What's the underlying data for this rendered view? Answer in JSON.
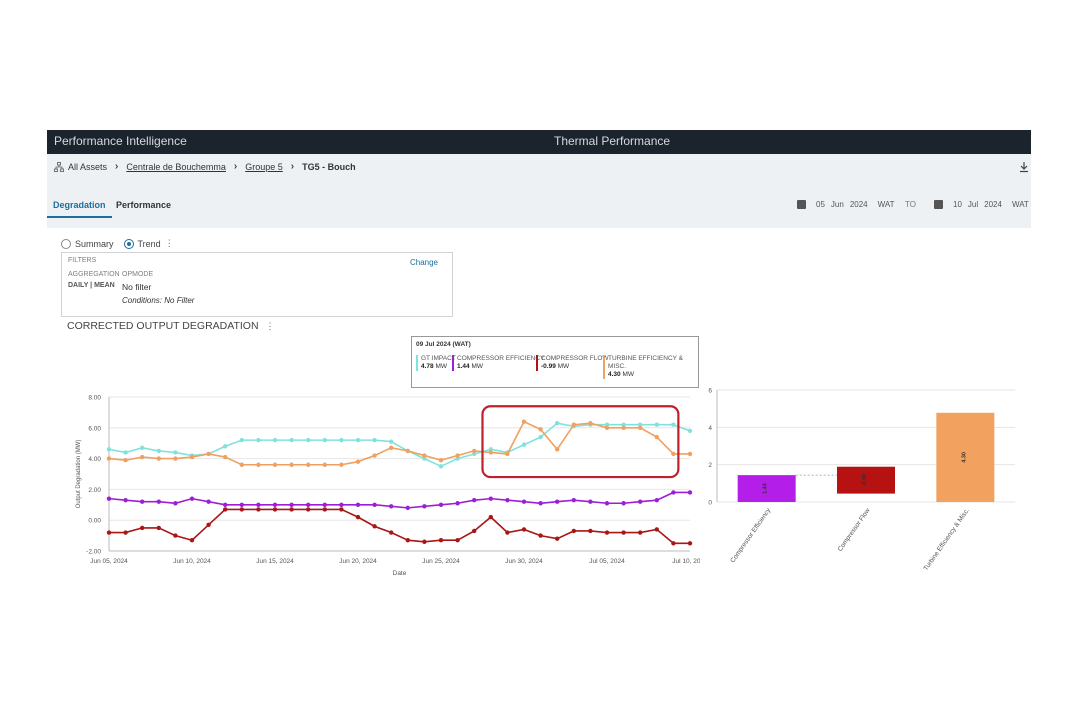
{
  "header": {
    "app_title": "Performance Intelligence",
    "page_title": "Thermal Performance"
  },
  "breadcrumb": {
    "items": [
      "All Assets",
      "Centrale de Bouchemma",
      "Groupe 5"
    ],
    "current": "TG5 - Bouch"
  },
  "tabs": [
    {
      "label": "Degradation",
      "active": true
    },
    {
      "label": "Performance",
      "active": false
    }
  ],
  "date_range": {
    "from": {
      "day": "05",
      "month": "Jun",
      "year": "2024",
      "tz": "WAT"
    },
    "to_label": "TO",
    "to": {
      "day": "10",
      "month": "Jul",
      "year": "2024",
      "tz": "WAT"
    }
  },
  "view_mode": {
    "options": [
      "Summary",
      "Trend"
    ],
    "selected": "Trend"
  },
  "filters": {
    "title": "FILTERS",
    "change_label": "Change",
    "aggregation_label": "AGGREGATION",
    "aggregation_value": "DAILY | MEAN",
    "opmode_label": "OPMODE",
    "opmode_value": "No filter",
    "conditions": "Conditions: No Filter"
  },
  "section_title": "CORRECTED OUTPUT DEGRADATION",
  "tooltip": {
    "date": "09 Jul 2024 (WAT)",
    "items": [
      {
        "name": "GT IMPACT",
        "value": "4.78",
        "unit": "MW",
        "color": "#7fe3dc"
      },
      {
        "name": "COMPRESSOR EFFICIENCY",
        "value": "1.44",
        "unit": "MW",
        "color": "#9b1fd6"
      },
      {
        "name": "COMPRESSOR FLOW",
        "value": "-0.99",
        "unit": "MW",
        "color": "#a81616"
      },
      {
        "name": "TURBINE EFFICIENCY & MISC.",
        "value": "4.30",
        "unit": "MW",
        "color": "#f0a060"
      }
    ]
  },
  "highlight_color": "#c0202a",
  "chart_data": [
    {
      "type": "line",
      "xlabel": "Date",
      "ylabel": "Output Degradation (MW)",
      "ylim": [
        -2,
        8
      ],
      "yticks": [
        "-2.00",
        "0.00",
        "2.00",
        "4.00",
        "6.00",
        "8.00"
      ],
      "xtick_labels": [
        "Jun 05, 2024",
        "Jun 10, 2024",
        "Jun 15, 2024",
        "Jun 20, 2024",
        "Jun 25, 2024",
        "Jun 30, 2024",
        "Jul 05, 2024",
        "Jul 10, 2024"
      ],
      "x_start": "2024-06-05",
      "x_days": 35,
      "grid": true,
      "series": [
        {
          "name": "GT IMPACT",
          "color": "#7fe3dc",
          "values": [
            4.6,
            4.4,
            4.7,
            4.5,
            4.4,
            4.2,
            4.3,
            4.8,
            5.2,
            5.2,
            5.2,
            5.2,
            5.2,
            5.2,
            5.2,
            5.2,
            5.2,
            5.1,
            4.5,
            4.0,
            3.5,
            4.0,
            4.3,
            4.6,
            4.4,
            4.9,
            5.4,
            6.3,
            6.1,
            6.2,
            6.2,
            6.2,
            6.2,
            6.2,
            6.2,
            5.8
          ]
        },
        {
          "name": "TURBINE EFFICIENCY & MISC.",
          "color": "#f0a060",
          "values": [
            4.0,
            3.9,
            4.1,
            4.0,
            4.0,
            4.1,
            4.3,
            4.1,
            3.6,
            3.6,
            3.6,
            3.6,
            3.6,
            3.6,
            3.6,
            3.8,
            4.2,
            4.7,
            4.5,
            4.2,
            3.9,
            4.2,
            4.5,
            4.4,
            4.3,
            6.4,
            5.9,
            4.6,
            6.2,
            6.3,
            6.0,
            6.0,
            6.0,
            5.4,
            4.3,
            4.3
          ]
        },
        {
          "name": "COMPRESSOR EFFICIENCY",
          "color": "#9b1fd6",
          "values": [
            1.4,
            1.3,
            1.2,
            1.2,
            1.1,
            1.4,
            1.2,
            1.0,
            1.0,
            1.0,
            1.0,
            1.0,
            1.0,
            1.0,
            1.0,
            1.0,
            1.0,
            0.9,
            0.8,
            0.9,
            1.0,
            1.1,
            1.3,
            1.4,
            1.3,
            1.2,
            1.1,
            1.2,
            1.3,
            1.2,
            1.1,
            1.1,
            1.2,
            1.3,
            1.8,
            1.8
          ]
        },
        {
          "name": "COMPRESSOR FLOW",
          "color": "#a81616",
          "values": [
            -0.8,
            -0.8,
            -0.5,
            -0.5,
            -1.0,
            -1.3,
            -0.3,
            0.7,
            0.7,
            0.7,
            0.7,
            0.7,
            0.7,
            0.7,
            0.7,
            0.2,
            -0.4,
            -0.8,
            -1.3,
            -1.4,
            -1.3,
            -1.3,
            -0.7,
            0.2,
            -0.8,
            -0.6,
            -1.0,
            -1.2,
            -0.7,
            -0.7,
            -0.8,
            -0.8,
            -0.8,
            -0.6,
            -1.5,
            -1.5
          ]
        }
      ]
    },
    {
      "type": "bar",
      "categories": [
        "Compressor Efficiency",
        "Compressor Flow",
        "Turbine Efficiency & Misc."
      ],
      "bar_labels": [
        "1.44",
        "-0.99",
        "4.30"
      ],
      "ylim": [
        0,
        6
      ],
      "yticks": [
        "0",
        "2",
        "4",
        "6"
      ],
      "bars": [
        {
          "base": 0,
          "value": 1.44,
          "color": "#b31ee8"
        },
        {
          "base": 0.45,
          "value": 1.44,
          "color": "#b71212"
        },
        {
          "base": 0,
          "value": 4.78,
          "color": "#f2a25e"
        }
      ]
    }
  ]
}
